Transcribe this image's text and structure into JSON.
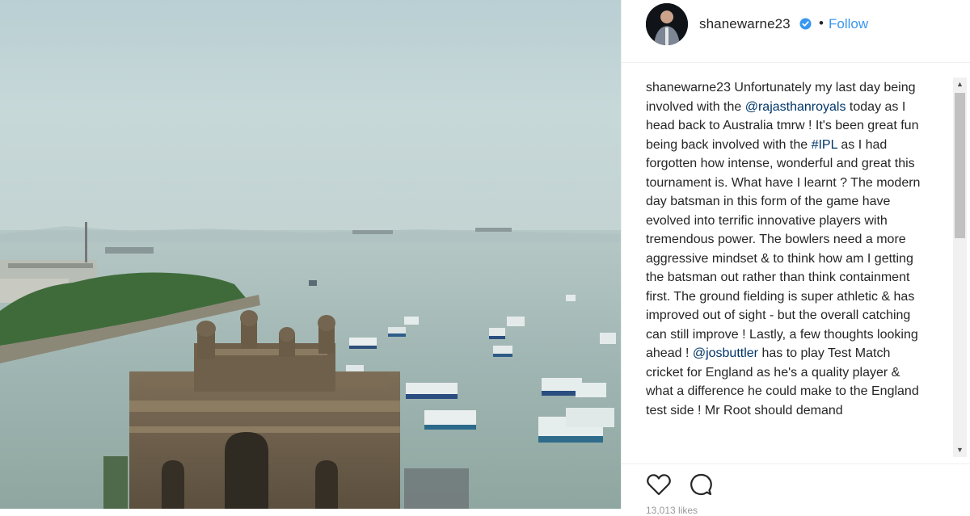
{
  "post": {
    "username": "shanewarne23",
    "verified_icon": "verified-badge-icon",
    "separator": "•",
    "follow_label": "Follow",
    "accent_color": "#3897f0"
  },
  "caption": {
    "username": "shanewarne23",
    "text_1": " Unfortunately my last day being involved with the ",
    "mention_1": "@rajasthanroyals",
    "text_2": " today as I head back to Australia tmrw ! It's been great fun being back involved with the ",
    "hashtag_1": "#IPL",
    "text_3": " as I had forgotten how intense, wonderful and great this tournament is. What have I learnt ? The modern day batsman in this form of the game have evolved into terrific innovative players with tremendous power. The bowlers need a more aggressive mindset & to think how am I getting the batsman out rather than think containment first. The ground fielding is super athletic & has improved out of sight - but the overall catching can still improve ! Lastly, a few thoughts looking ahead ! ",
    "mention_2": "@josbuttler",
    "text_4": " has to play Test Match cricket for England as he's a quality player & what a difference he could make to the England test side ! Mr Root should demand"
  },
  "actions": {
    "like_icon": "heart-icon",
    "comment_icon": "comment-icon",
    "likes_text": "13,013 likes"
  },
  "photo": {
    "subject": "gateway-of-india-harbour-photo"
  }
}
